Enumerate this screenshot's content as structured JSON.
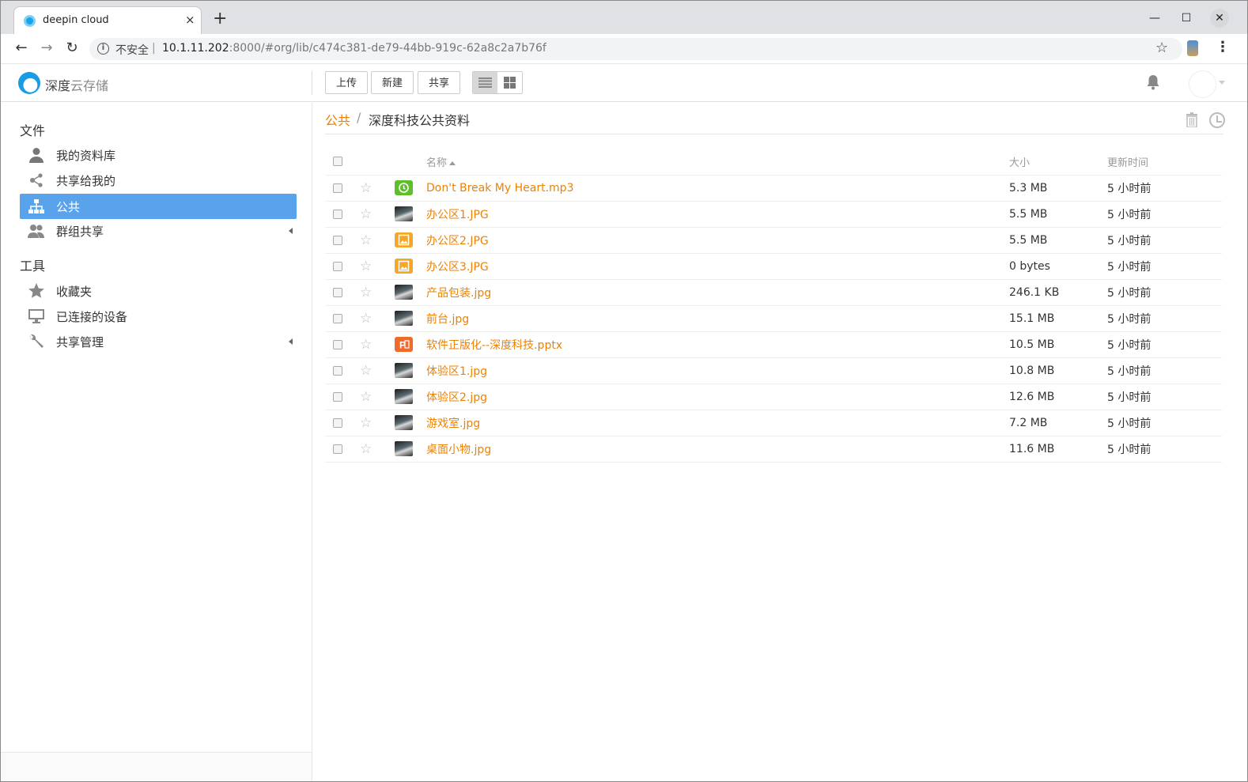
{
  "browser": {
    "tab_title": "deepin cloud",
    "tab_close": "×",
    "new_tab": "+",
    "security_label": "不安全",
    "url_host": "10.1.11.202",
    "url_rest": ":8000/#org/lib/c474c381-de79-44bb-919c-62a8c2a7b76f"
  },
  "app": {
    "logo_strong": "深度",
    "logo_light": "云存储",
    "buttons": {
      "upload": "上传",
      "new": "新建",
      "share": "共享"
    }
  },
  "sidebar": {
    "files_heading": "文件",
    "tools_heading": "工具",
    "items": [
      {
        "label": "我的资料库",
        "icon": "user-icon"
      },
      {
        "label": "共享给我的",
        "icon": "share-nodes-icon"
      },
      {
        "label": "公共",
        "icon": "org-tree-icon",
        "active": true
      },
      {
        "label": "群组共享",
        "icon": "group-icon"
      }
    ],
    "tools": [
      {
        "label": "收藏夹",
        "icon": "star-icon"
      },
      {
        "label": "已连接的设备",
        "icon": "monitor-icon"
      },
      {
        "label": "共享管理",
        "icon": "wrench-icon"
      }
    ]
  },
  "breadcrumb": {
    "root": "公共",
    "separator": "/",
    "current": "深度科技公共资料"
  },
  "table": {
    "headers": {
      "name": "名称",
      "size": "大小",
      "updated": "更新时间"
    },
    "rows": [
      {
        "name": "Don't Break My Heart.mp3",
        "size": "5.3 MB",
        "updated": "5 小时前",
        "icon": "audio-file-icon"
      },
      {
        "name": "办公区1.JPG",
        "size": "5.5 MB",
        "updated": "5 小时前",
        "icon": "image-thumbnail"
      },
      {
        "name": "办公区2.JPG",
        "size": "5.5 MB",
        "updated": "5 小时前",
        "icon": "image-file-icon"
      },
      {
        "name": "办公区3.JPG",
        "size": "0 bytes",
        "updated": "5 小时前",
        "icon": "image-file-icon"
      },
      {
        "name": "产品包装.jpg",
        "size": "246.1 KB",
        "updated": "5 小时前",
        "icon": "image-thumbnail"
      },
      {
        "name": "前台.jpg",
        "size": "15.1 MB",
        "updated": "5 小时前",
        "icon": "image-thumbnail"
      },
      {
        "name": "软件正版化--深度科技.pptx",
        "size": "10.5 MB",
        "updated": "5 小时前",
        "icon": "pptx-file-icon"
      },
      {
        "name": "体验区1.jpg",
        "size": "10.8 MB",
        "updated": "5 小时前",
        "icon": "image-thumbnail"
      },
      {
        "name": "体验区2.jpg",
        "size": "12.6 MB",
        "updated": "5 小时前",
        "icon": "image-thumbnail"
      },
      {
        "name": "游戏室.jpg",
        "size": "7.2 MB",
        "updated": "5 小时前",
        "icon": "image-thumbnail"
      },
      {
        "name": "桌面小物.jpg",
        "size": "11.6 MB",
        "updated": "5 小时前",
        "icon": "image-thumbnail"
      }
    ]
  },
  "colors": {
    "accent": "#eb8205",
    "active_nav": "#58a3eb"
  }
}
